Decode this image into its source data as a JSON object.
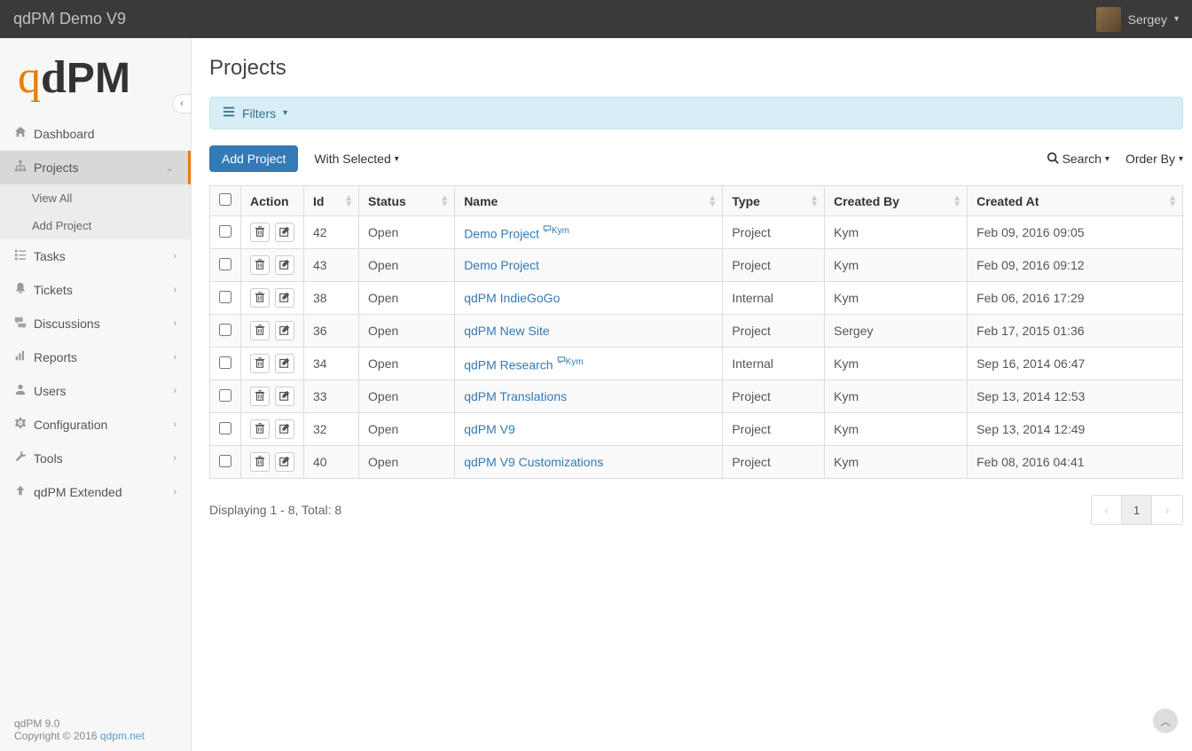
{
  "topbar": {
    "title": "qdPM Demo V9",
    "username": "Sergey"
  },
  "sidebar": {
    "items": [
      {
        "icon": "home",
        "label": "Dashboard",
        "expandable": false
      },
      {
        "icon": "sitemap",
        "label": "Projects",
        "expandable": true,
        "active": true,
        "sub": [
          {
            "label": "View All"
          },
          {
            "label": "Add Project"
          }
        ]
      },
      {
        "icon": "tasks",
        "label": "Tasks",
        "expandable": true
      },
      {
        "icon": "bell",
        "label": "Tickets",
        "expandable": true
      },
      {
        "icon": "comments",
        "label": "Discussions",
        "expandable": true
      },
      {
        "icon": "chart",
        "label": "Reports",
        "expandable": true
      },
      {
        "icon": "user",
        "label": "Users",
        "expandable": true
      },
      {
        "icon": "gear",
        "label": "Configuration",
        "expandable": true
      },
      {
        "icon": "wrench",
        "label": "Tools",
        "expandable": true
      },
      {
        "icon": "uparrow",
        "label": "qdPM Extended",
        "expandable": true
      }
    ],
    "footer": {
      "version": "qdPM 9.0",
      "copyright": "Copyright © 2016 ",
      "link": "qdpm.net"
    }
  },
  "main": {
    "page_title": "Projects",
    "filters_label": "Filters",
    "toolbar": {
      "add_label": "Add Project",
      "with_selected_label": "With Selected",
      "search_label": "Search",
      "order_by_label": "Order By"
    },
    "table": {
      "headers": {
        "action": "Action",
        "id": "Id",
        "status": "Status",
        "name": "Name",
        "type": "Type",
        "created_by": "Created By",
        "created_at": "Created At"
      },
      "rows": [
        {
          "id": "42",
          "status": "Open",
          "name": "Demo Project",
          "comment": "Kym",
          "type": "Project",
          "created_by": "Kym",
          "created_at": "Feb 09, 2016 09:05"
        },
        {
          "id": "43",
          "status": "Open",
          "name": "Demo Project",
          "comment": "",
          "type": "Project",
          "created_by": "Kym",
          "created_at": "Feb 09, 2016 09:12"
        },
        {
          "id": "38",
          "status": "Open",
          "name": "qdPM IndieGoGo",
          "comment": "",
          "type": "Internal",
          "created_by": "Kym",
          "created_at": "Feb 06, 2016 17:29"
        },
        {
          "id": "36",
          "status": "Open",
          "name": "qdPM New Site",
          "comment": "",
          "type": "Project",
          "created_by": "Sergey",
          "created_at": "Feb 17, 2015 01:36"
        },
        {
          "id": "34",
          "status": "Open",
          "name": "qdPM Research",
          "comment": "Kym",
          "type": "Internal",
          "created_by": "Kym",
          "created_at": "Sep 16, 2014 06:47"
        },
        {
          "id": "33",
          "status": "Open",
          "name": "qdPM Translations",
          "comment": "",
          "type": "Project",
          "created_by": "Kym",
          "created_at": "Sep 13, 2014 12:53"
        },
        {
          "id": "32",
          "status": "Open",
          "name": "qdPM V9",
          "comment": "",
          "type": "Project",
          "created_by": "Kym",
          "created_at": "Sep 13, 2014 12:49"
        },
        {
          "id": "40",
          "status": "Open",
          "name": "qdPM V9 Customizations",
          "comment": "",
          "type": "Project",
          "created_by": "Kym",
          "created_at": "Feb 08, 2016 04:41"
        }
      ]
    },
    "footer_info": "Displaying 1 - 8, Total: 8",
    "pagination": {
      "current": "1"
    }
  }
}
